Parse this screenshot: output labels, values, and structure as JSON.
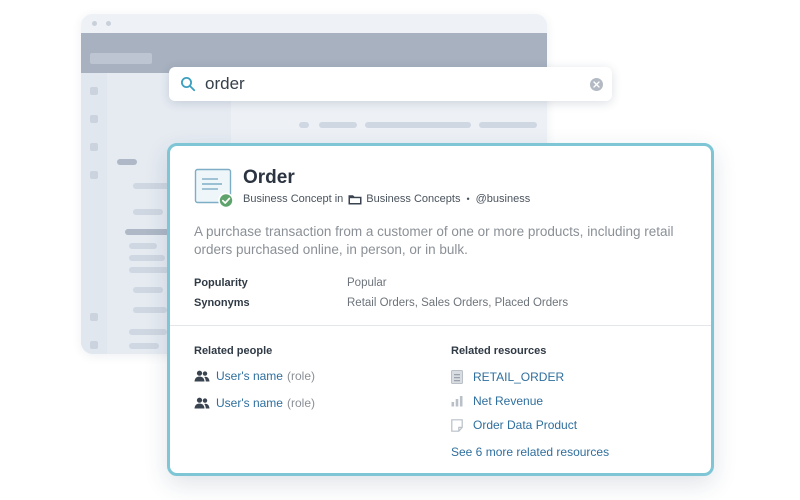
{
  "search": {
    "query": "order"
  },
  "card": {
    "title": "Order",
    "entity_type": "Business Concept in",
    "collection": "Business Concepts",
    "separator": "•",
    "owner": "@business",
    "description": "A purchase transaction from a customer of one or more products, including retail orders purchased online, in person, or in bulk.",
    "properties": [
      {
        "label": "Popularity",
        "value": "Popular"
      },
      {
        "label": "Synonyms",
        "value": "Retail Orders, Sales Orders, Placed Orders"
      }
    ],
    "related_people": {
      "heading": "Related people",
      "items": [
        {
          "name": "User's name",
          "role": "(role)"
        },
        {
          "name": "User's name",
          "role": "(role)"
        }
      ]
    },
    "related_resources": {
      "heading": "Related resources",
      "items": [
        {
          "name": "RETAIL_ORDER",
          "icon": "table-icon"
        },
        {
          "name": "Net Revenue",
          "icon": "metric-icon"
        },
        {
          "name": "Order Data Product",
          "icon": "data-product-icon"
        }
      ],
      "more_link": "See 6 more related resources"
    }
  },
  "colors": {
    "card_border": "#7ec6d6",
    "link": "#2f6f9e",
    "verified_badge": "#5fa36c"
  }
}
